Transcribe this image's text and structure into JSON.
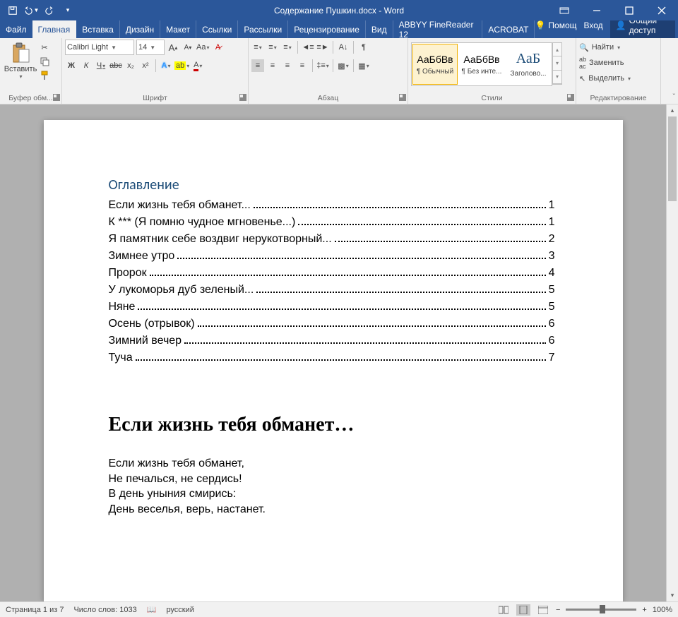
{
  "title": "Содержание Пушкин.docx - Word",
  "tabs": [
    "Файл",
    "Главная",
    "Вставка",
    "Дизайн",
    "Макет",
    "Ссылки",
    "Рассылки",
    "Рецензирование",
    "Вид",
    "ABBYY FineReader 12",
    "ACROBAT"
  ],
  "active_tab": 1,
  "help": "Помощ",
  "login": "Вход",
  "share": "Общий доступ",
  "clipboard": {
    "paste": "Вставить",
    "label": "Буфер обм..."
  },
  "font": {
    "name": "Calibri Light",
    "size": "14",
    "label": "Шрифт",
    "bold": "Ж",
    "italic": "К",
    "underline": "Ч",
    "strike": "abc",
    "sub": "x₂",
    "sup": "x²",
    "case": "Aa",
    "clear": "⌫",
    "bigA": "A",
    "smallA": "A",
    "textfx": "A",
    "highlight": "⬛",
    "color": "A"
  },
  "para": {
    "label": "Абзац"
  },
  "styles": {
    "label": "Стили",
    "items": [
      {
        "prev": "АаБбВв",
        "name": "¶ Обычный"
      },
      {
        "prev": "АаБбВв",
        "name": "¶ Без инте..."
      },
      {
        "prev": "АаБ",
        "name": "Заголово..."
      }
    ]
  },
  "editing": {
    "label": "Редактирование",
    "find": "Найти",
    "replace": "Заменить",
    "select": "Выделить"
  },
  "document": {
    "toc_title": "Оглавление",
    "toc": [
      {
        "t": "Если жизнь тебя обманет...",
        "p": "1"
      },
      {
        "t": "К *** (Я помню чудное мгновенье...)",
        "p": "1"
      },
      {
        "t": "Я памятник себе воздвиг нерукотворный...",
        "p": "2"
      },
      {
        "t": "Зимнее утро",
        "p": "3"
      },
      {
        "t": "Пророк",
        "p": "4"
      },
      {
        "t": "У лукоморья дуб зеленый...",
        "p": "5"
      },
      {
        "t": "Няне",
        "p": "5"
      },
      {
        "t": "Осень (отрывок)",
        "p": "6"
      },
      {
        "t": "Зимний вечер",
        "p": "6"
      },
      {
        "t": "Туча",
        "p": "7"
      }
    ],
    "heading": "Если жизнь тебя обманет…",
    "body": [
      "Если жизнь тебя обманет,",
      "Не печалься, не сердись!",
      "В день уныния смирись:",
      "День веселья, верь, настанет."
    ]
  },
  "status": {
    "page": "Страница 1 из 7",
    "words": "Число слов: 1033",
    "lang": "русский",
    "zoom": "100%"
  }
}
